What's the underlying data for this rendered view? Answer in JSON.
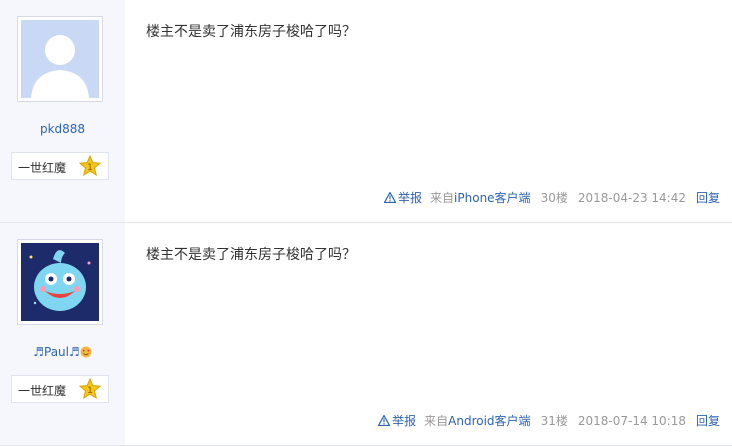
{
  "posts": [
    {
      "username": "pkd888",
      "level_name": "一世红魔",
      "level_num": "1",
      "content": "楼主不是卖了浦东房子梭哈了吗？",
      "report_label": "举报",
      "device_prefix": "来自",
      "device_name": "iPhone客户端",
      "floor": "30楼",
      "time": "2018-04-23 14:42",
      "reply_label": "回复",
      "avatar_icon": "default-user-silhouette"
    },
    {
      "username": "♬Paul♬",
      "level_name": "一世红魔",
      "level_num": "1",
      "content": "楼主不是卖了浦东房子梭哈了吗？",
      "report_label": "举报",
      "device_prefix": "来自",
      "device_name": "Android客户端",
      "floor": "31楼",
      "time": "2018-07-14 10:18",
      "reply_label": "回复",
      "avatar_icon": "cartoon-blue-creature"
    }
  ],
  "colors": {
    "link": "#2d64b3",
    "sidebar_bg": "#f6f7fd",
    "badge": "#f5c518"
  }
}
